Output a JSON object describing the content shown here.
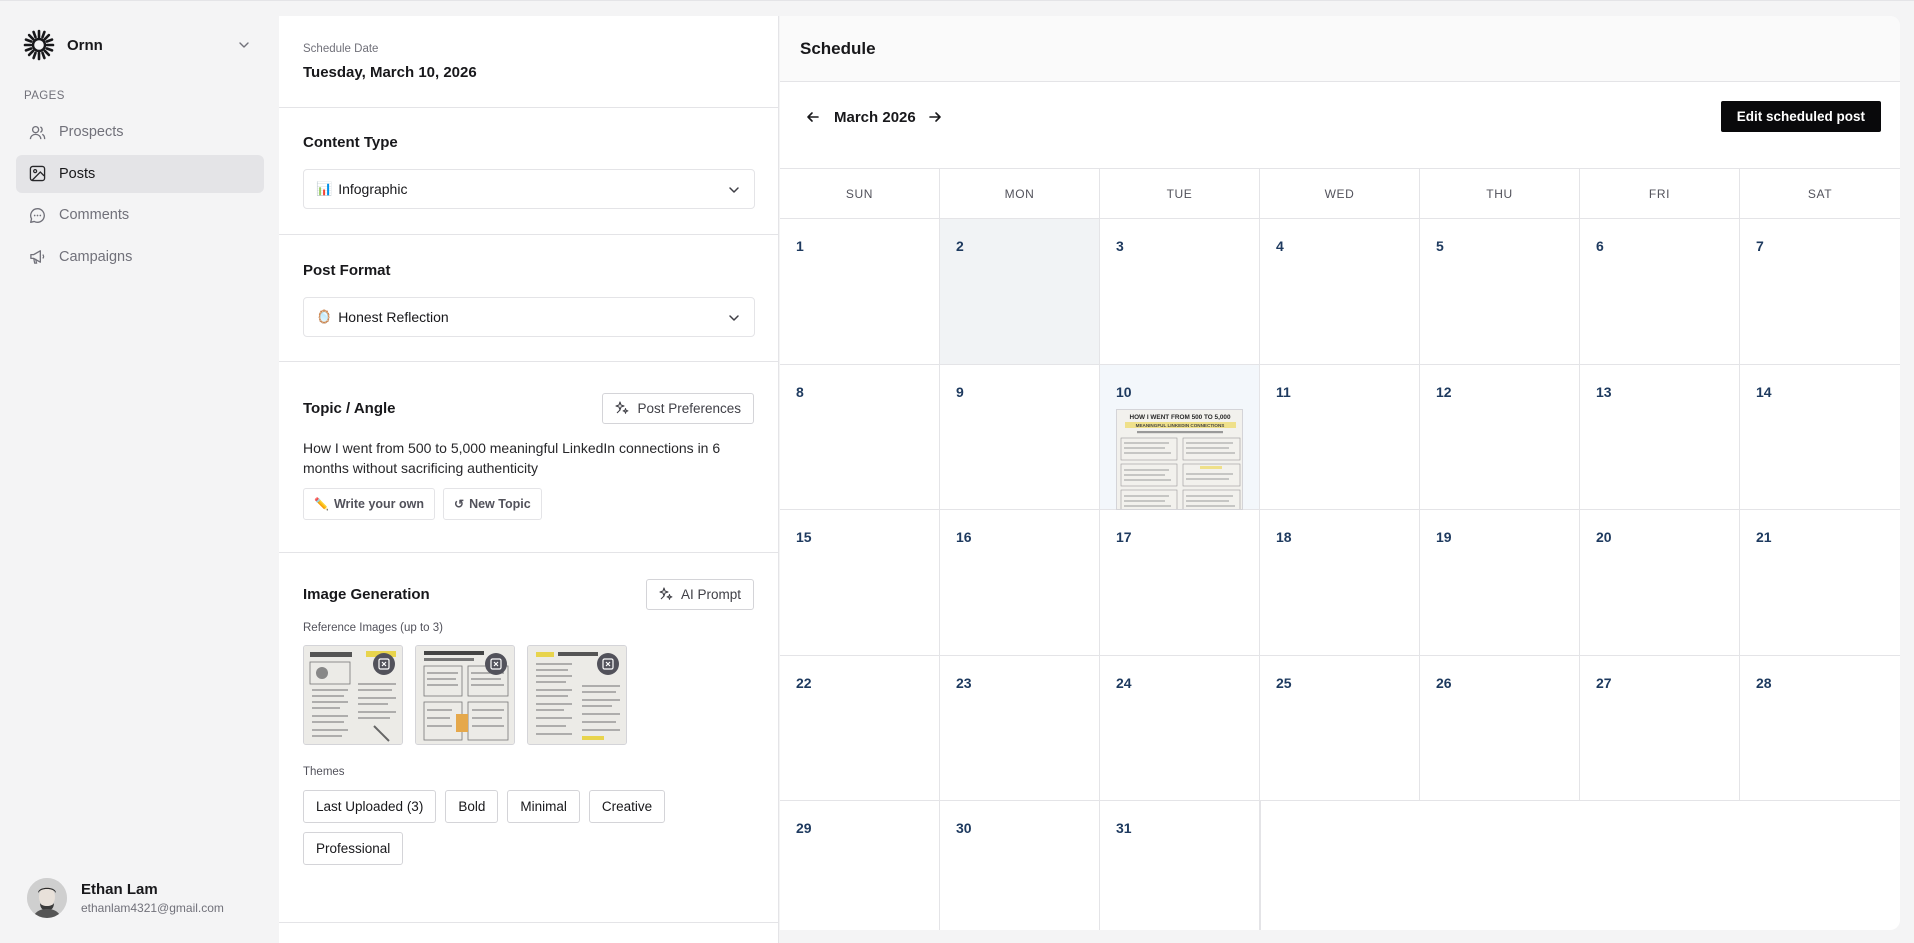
{
  "sidebar": {
    "brand": "Ornn",
    "section_label": "PAGES",
    "items": [
      {
        "label": "Prospects",
        "icon": "user-icon"
      },
      {
        "label": "Posts",
        "icon": "image-icon"
      },
      {
        "label": "Comments",
        "icon": "message-circle-icon"
      },
      {
        "label": "Campaigns",
        "icon": "megaphone-icon"
      }
    ],
    "active_item": "Posts",
    "user": {
      "name": "Ethan Lam",
      "email": "ethanlam4321@gmail.com"
    }
  },
  "form": {
    "schedule_date_label": "Schedule Date",
    "schedule_date_value": "Tuesday, March 10, 2026",
    "content_type": {
      "title": "Content Type",
      "emoji": "📊",
      "value": "Infographic"
    },
    "post_format": {
      "title": "Post Format",
      "emoji": "🪞",
      "value": "Honest Reflection"
    },
    "topic": {
      "title": "Topic / Angle",
      "preferences_label": "Post Preferences",
      "text": "How I went from 500 to 5,000 meaningful LinkedIn connections in 6 months without sacrificing authenticity",
      "write_own_label": "Write your own",
      "write_own_emoji": "✏️",
      "new_topic_label": "New Topic",
      "new_topic_emoji": "↺"
    },
    "image_generation": {
      "title": "Image Generation",
      "ai_prompt_label": "AI Prompt",
      "reference_label": "Reference Images (up to 3)",
      "reference_count": 3,
      "themes_label": "Themes",
      "themes": [
        "Last Uploaded (3)",
        "Bold",
        "Minimal",
        "Creative",
        "Professional"
      ]
    }
  },
  "schedule": {
    "title": "Schedule",
    "month_label": "March 2026",
    "edit_button": "Edit scheduled post",
    "weekdays": [
      "SUN",
      "MON",
      "TUE",
      "WED",
      "THU",
      "FRI",
      "SAT"
    ],
    "weeks": [
      [
        "1",
        "2",
        "3",
        "4",
        "5",
        "6",
        "7"
      ],
      [
        "8",
        "9",
        "10",
        "11",
        "12",
        "13",
        "14"
      ],
      [
        "15",
        "16",
        "17",
        "18",
        "19",
        "20",
        "21"
      ],
      [
        "22",
        "23",
        "24",
        "25",
        "26",
        "27",
        "28"
      ],
      [
        "29",
        "30",
        "31",
        "",
        "",
        "",
        ""
      ]
    ],
    "highlighted_day": "2",
    "selected_day": "10",
    "scheduled_post": {
      "day": "10",
      "headline": "HOW I WENT FROM 500 TO 5,000",
      "subheadline": "MEANINGFUL LINKEDIN CONNECTIONS"
    }
  }
}
